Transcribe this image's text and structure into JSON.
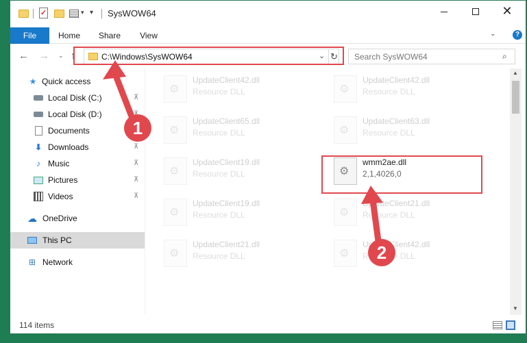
{
  "window": {
    "title": "SysWOW64",
    "controls": {
      "minimize": "—",
      "maximize": "☐",
      "close": "✕"
    }
  },
  "quick_access_toolbar": {
    "dropdown": "▾",
    "customize": "▾"
  },
  "ribbon": {
    "tabs": [
      "File",
      "Home",
      "Share",
      "View"
    ],
    "expand": "⌄",
    "help": "?"
  },
  "navigation": {
    "back": "←",
    "forward": "→",
    "recent": "⌄",
    "up": "↑",
    "address": "C:\\Windows\\SysWOW64",
    "address_dropdown": "⌄",
    "refresh": "↻",
    "search_placeholder": "Search SysWOW64",
    "search_icon": "⌕"
  },
  "sidebar": {
    "items": [
      {
        "label": "Quick access",
        "icon": "star-icon",
        "pinned": false
      },
      {
        "label": "Local Disk (C:)",
        "icon": "drive-icon",
        "pinned": true
      },
      {
        "label": "Local Disk (D:)",
        "icon": "drive-icon",
        "pinned": true
      },
      {
        "label": "Documents",
        "icon": "document-icon",
        "pinned": true
      },
      {
        "label": "Downloads",
        "icon": "download-icon",
        "pinned": true
      },
      {
        "label": "Music",
        "icon": "music-icon",
        "pinned": true
      },
      {
        "label": "Pictures",
        "icon": "pictures-icon",
        "pinned": true
      },
      {
        "label": "Videos",
        "icon": "videos-icon",
        "pinned": true
      },
      {
        "label": "OneDrive",
        "icon": "cloud-icon",
        "pinned": false
      },
      {
        "label": "This PC",
        "icon": "computer-icon",
        "pinned": false,
        "selected": true
      },
      {
        "label": "Network",
        "icon": "network-icon",
        "pinned": false
      }
    ],
    "pin_glyph": "📌"
  },
  "files": [
    {
      "name": "UpdateClient42.dll",
      "type": "Resource DLL",
      "faded": true
    },
    {
      "name": "UpdateClient42.dll",
      "type": "Resource DLL",
      "faded": true
    },
    {
      "name": "UpdateClient65.dll",
      "type": "Resource DLL",
      "faded": true
    },
    {
      "name": "UpdateClient63.dll",
      "type": "Resource DLL",
      "faded": true
    },
    {
      "name": "UpdateClient19.dll",
      "type": "Resource DLL",
      "faded": true
    },
    {
      "name": "wmm2ae.dll",
      "type": "2,1,4026,0",
      "faded": false
    },
    {
      "name": "UpdateClient19.dll",
      "type": "Resource DLL",
      "faded": true
    },
    {
      "name": "UpdateClient21.dll",
      "type": "Resource DLL",
      "faded": true
    },
    {
      "name": "UpdateClient21.dll",
      "type": "Resource DLL",
      "faded": true
    },
    {
      "name": "UpdateClient42.dll",
      "type": "Resource DLL",
      "faded": true
    }
  ],
  "status": {
    "item_count": "114 items"
  },
  "annotations": {
    "step1": "1",
    "step2": "2",
    "color": "#e0484e"
  }
}
